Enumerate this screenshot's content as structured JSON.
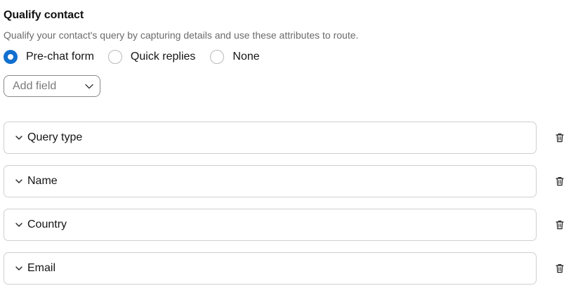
{
  "section": {
    "title": "Qualify contact",
    "description": "Qualify your contact's query by capturing details and use these attributes to route."
  },
  "mode_options": [
    {
      "label": "Pre-chat form",
      "selected": true
    },
    {
      "label": "Quick replies",
      "selected": false
    },
    {
      "label": "None",
      "selected": false
    }
  ],
  "add_field": {
    "placeholder": "Add field",
    "icon": "chevron-down-icon"
  },
  "fields": [
    {
      "label": "Query type",
      "icon": "chevron-down-icon",
      "delete_icon": "trash-icon"
    },
    {
      "label": "Name",
      "icon": "chevron-down-icon",
      "delete_icon": "trash-icon"
    },
    {
      "label": "Country",
      "icon": "chevron-down-icon",
      "delete_icon": "trash-icon"
    },
    {
      "label": "Email",
      "icon": "chevron-down-icon",
      "delete_icon": "trash-icon"
    }
  ],
  "colors": {
    "accent": "#1170cf",
    "border": "#cfcfcf",
    "muted_text": "#6b6b6b"
  }
}
